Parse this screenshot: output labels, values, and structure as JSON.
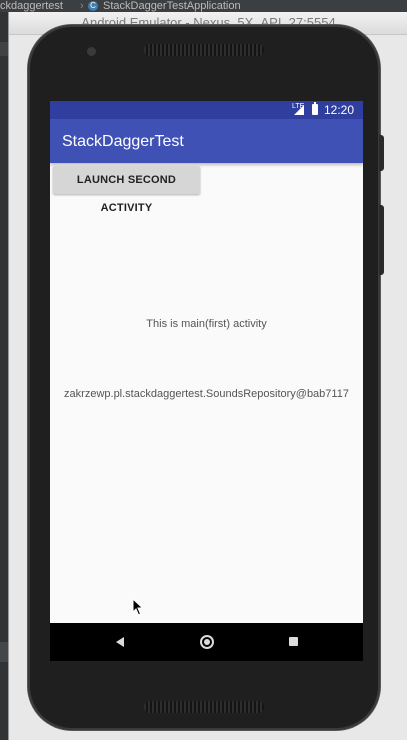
{
  "ide": {
    "breadcrumb": "ckdaggertest",
    "class_icon_letter": "C",
    "class_name": "StackDaggerTestApplication"
  },
  "emulator": {
    "window_title": "Android Emulator - Nexus_5X_API_27:5554"
  },
  "status_bar": {
    "network": "LTE",
    "time": "12:20"
  },
  "app_bar": {
    "title": "StackDaggerTest"
  },
  "content": {
    "launch_button_label": "LAUNCH SECOND ACTIVITY",
    "main_text": "This is main(first) activity",
    "repository_text": "zakrzewp.pl.stackdaggertest.SoundsRepository@bab7117"
  },
  "icons": {
    "signal": "signal-icon",
    "battery": "battery-icon",
    "back": "nav-back-icon",
    "home": "nav-home-icon",
    "recents": "nav-recents-icon",
    "cursor": "mouse-cursor-icon"
  },
  "colors": {
    "status_bar": "#303f9f",
    "app_bar": "#3f51b5",
    "screen_background": "#fafafa",
    "button_background": "#d6d6d6"
  }
}
